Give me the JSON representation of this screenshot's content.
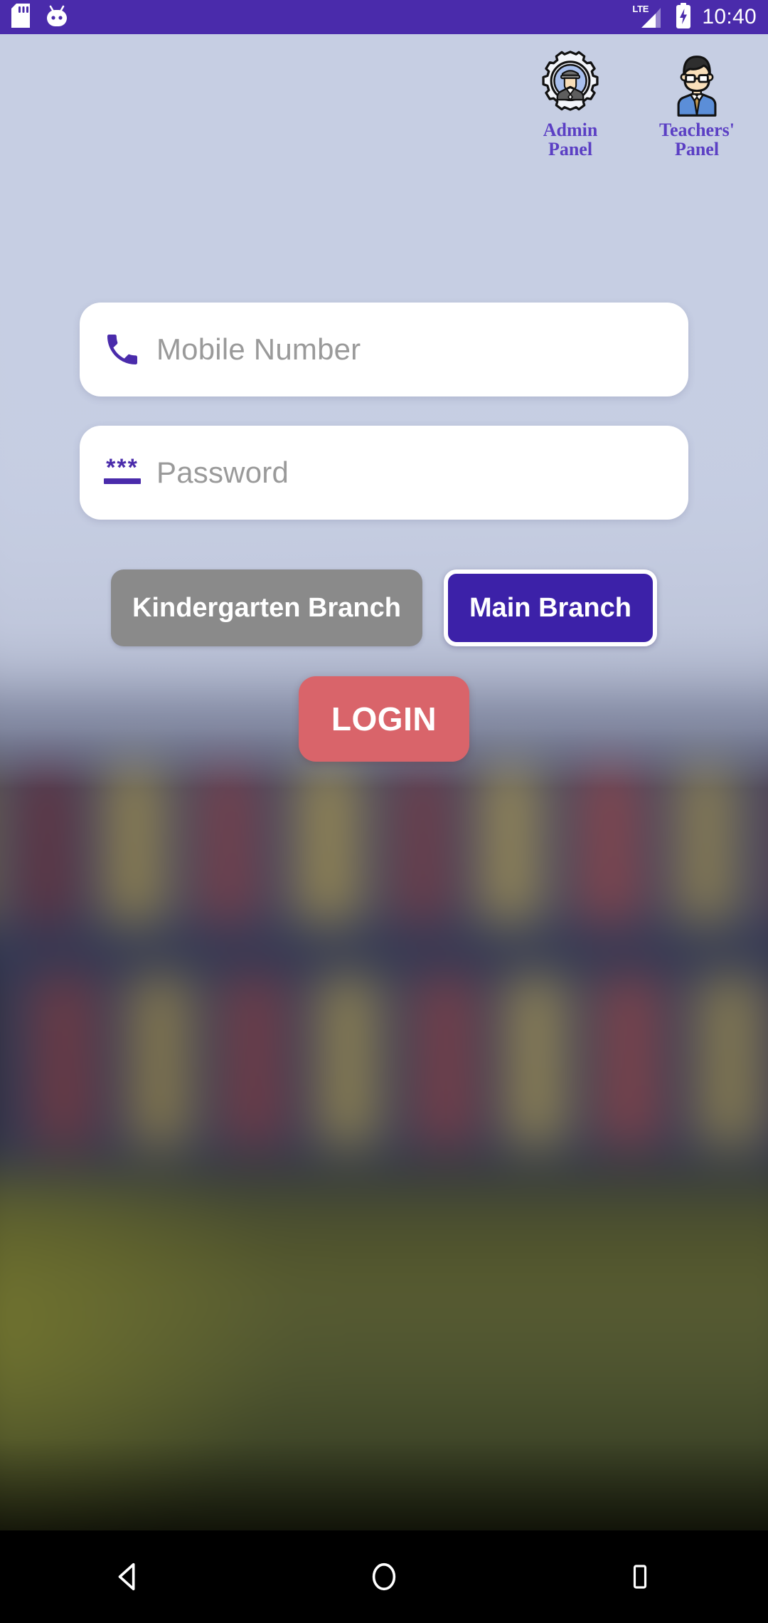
{
  "status_bar": {
    "background_color": "#4a2bab",
    "left_icons": [
      {
        "name": "sd-card-icon",
        "label": "SD card"
      },
      {
        "name": "android-face-icon",
        "label": "Android system"
      }
    ],
    "network": "LTE",
    "battery": "charging",
    "time": "10:40"
  },
  "panels": [
    {
      "label_line1": "Admin",
      "label_line2": "Panel",
      "icon": "admin-gear-user-icon"
    },
    {
      "label_line1": "Teachers'",
      "label_line2": "Panel",
      "icon": "teacher-avatar-icon"
    }
  ],
  "form": {
    "mobile": {
      "icon": "phone-icon",
      "value": "",
      "placeholder": "Mobile Number"
    },
    "password": {
      "icon": "password-asterisks-icon",
      "value": "",
      "placeholder": "Password"
    }
  },
  "branches": [
    {
      "label": "Kindergarten Branch",
      "selected": false,
      "color": "#8a8a8a"
    },
    {
      "label": "Main Branch",
      "selected": true,
      "color": "#3c21a8"
    }
  ],
  "login": {
    "label": "LOGIN",
    "color": "#d9646a"
  },
  "nav_bar": [
    {
      "name": "back-button",
      "icon": "triangle-left"
    },
    {
      "name": "home-button",
      "icon": "circle"
    },
    {
      "name": "recents-button",
      "icon": "square"
    }
  ],
  "theme": {
    "primary": "#4a2bab",
    "accent_label": "#5b3fc4",
    "scrim": "#c6cee3",
    "placeholder_text": "#9a9a9a"
  }
}
